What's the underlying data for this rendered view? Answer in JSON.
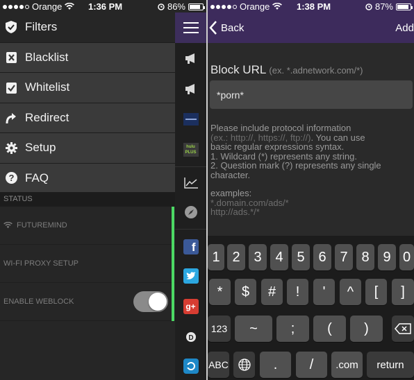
{
  "left": {
    "status": {
      "carrier": "Orange",
      "time": "1:36 PM",
      "battery": "86%",
      "battery_level": 0.86
    },
    "menu": [
      {
        "label": "Filters",
        "icon": "shield-icon"
      },
      {
        "label": "Blacklist",
        "icon": "x-box-icon"
      },
      {
        "label": "Whitelist",
        "icon": "check-box-icon"
      },
      {
        "label": "Redirect",
        "icon": "redirect-arrow-icon"
      },
      {
        "label": "Setup",
        "icon": "gear-icon"
      },
      {
        "label": "FAQ",
        "icon": "question-icon"
      }
    ],
    "status_header": "STATUS",
    "status_rows": [
      {
        "label": "FUTUREMIND",
        "icon": "wifi-icon"
      },
      {
        "label": "WI-FI PROXY SETUP"
      },
      {
        "label": "ENABLE WEBLOCK",
        "toggle_on": true
      }
    ],
    "strip_icons": [
      "menu-icon",
      "megaphone-icon",
      "megaphone-icon",
      "pandora-icon",
      "hulu-plus-icon",
      "chart-icon",
      "compass-icon",
      "facebook-icon",
      "twitter-icon",
      "google-plus-icon",
      "disqus-icon",
      "app-icon"
    ],
    "hulu_text": "hulu PLUS"
  },
  "right": {
    "status": {
      "carrier": "Orange",
      "time": "1:38 PM",
      "battery": "87%",
      "battery_level": 0.87
    },
    "nav": {
      "back": "Back",
      "add": "Add"
    },
    "field": {
      "label": "Block URL",
      "hint": "(ex. *.adnetwork.com/*)",
      "value": "*porn*"
    },
    "help": {
      "line1": "Please include protocol information",
      "line2_dim": "(ex.: http://, https://, ftp://)",
      "line2_rest": ". You can use",
      "line3": "basic regular expressions syntax.",
      "line4": "1. Wildcard (*) represents any string.",
      "line5": "2. Question mark (?) represents any single",
      "line6": "character.",
      "examples_label": "examples:",
      "example1": "*.domain.com/ads/*",
      "example2": "http://ads.*/*"
    },
    "keyboard": {
      "row1": [
        "1",
        "2",
        "3",
        "4",
        "5",
        "6",
        "7",
        "8",
        "9",
        "0"
      ],
      "row2": [
        "*",
        "$",
        "#",
        "!",
        "'",
        "^",
        "[",
        "]"
      ],
      "row3": [
        "123",
        "~",
        ";",
        "(",
        ")",
        "backspace"
      ],
      "row4": [
        "ABC",
        "globe",
        ".",
        "/",
        ".com",
        "return"
      ]
    }
  }
}
